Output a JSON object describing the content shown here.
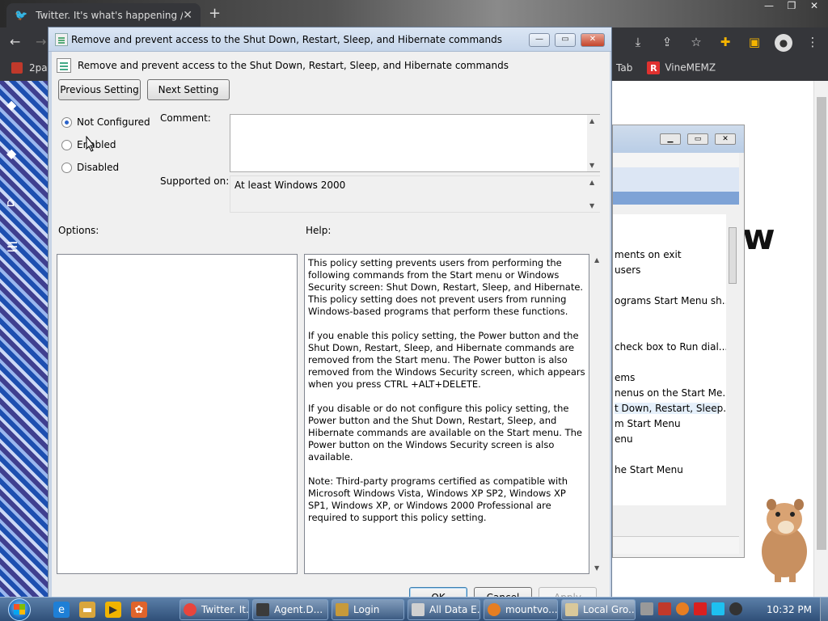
{
  "browser": {
    "tab_title": "Twitter. It's what's happening / T",
    "tab_close": "✕",
    "new_tab": "+",
    "bookmarks_left": "2pa",
    "bookmarks_right": [
      "Tab",
      "VineMEMZ"
    ]
  },
  "background_window": {
    "list_items": [
      "ments on exit",
      "users",
      "ograms Start Menu sh...",
      "check box to Run dial...",
      "ems",
      "nenus on the Start Me...",
      "t Down, Restart, Sleep...",
      "m Start Menu",
      "enu",
      "he Start Menu"
    ],
    "selected_index": 6,
    "big_text": "w"
  },
  "dialog": {
    "title": "Remove and prevent access to the Shut Down, Restart, Sleep, and Hibernate commands",
    "header": "Remove and prevent access to the Shut Down, Restart, Sleep, and Hibernate commands",
    "prev_button": "Previous Setting",
    "next_button": "Next Setting",
    "radios": [
      {
        "label": "Not Configured",
        "selected": true
      },
      {
        "label": "Enabled",
        "selected": false
      },
      {
        "label": "Disabled",
        "selected": false
      }
    ],
    "comment_label": "Comment:",
    "comment_value": "",
    "supported_label": "Supported on:",
    "supported_value": "At least Windows 2000",
    "options_label": "Options:",
    "help_label": "Help:",
    "help_paragraphs": [
      "This policy setting prevents users from performing the following commands from the Start menu or Windows Security screen: Shut Down, Restart, Sleep, and Hibernate. This policy setting does not prevent users from running Windows-based programs that perform these functions.",
      "If you enable this policy setting, the Power button and the Shut Down, Restart, Sleep, and Hibernate commands are removed from the Start menu. The Power button is also removed from the Windows Security screen, which appears when you press CTRL +ALT+DELETE.",
      "If you disable or do not configure this policy setting, the Power button and the Shut Down, Restart, Sleep, and Hibernate commands are available on the Start menu. The Power button on the Windows Security screen is also available.",
      "Note: Third-party programs certified as compatible with Microsoft Windows Vista, Windows XP SP2, Windows XP SP1, Windows XP, or Windows 2000 Professional are required to support this policy setting."
    ],
    "ok_button": "OK",
    "cancel_button": "Cancel",
    "apply_button": "Apply"
  },
  "taskbar": {
    "buttons": [
      {
        "label": "Twitter. It...",
        "color": "#e8453c"
      },
      {
        "label": "Agent.D...",
        "color": "#3b3b3b"
      },
      {
        "label": "Login",
        "color": "#c79a3a"
      },
      {
        "label": "All Data E...",
        "color": "#d0d0d0"
      },
      {
        "label": "mountvo...",
        "color": "#e67e22"
      },
      {
        "label": "Local Gro...",
        "color": "#d9c89a"
      }
    ],
    "clock": "10:32 PM"
  },
  "colors": {
    "dialog_bg": "#f0f0f0",
    "title_gradient_top": "#dbe6f4",
    "radio_accent": "#2a62c9",
    "taskbar_top": "#5b7fa8"
  }
}
